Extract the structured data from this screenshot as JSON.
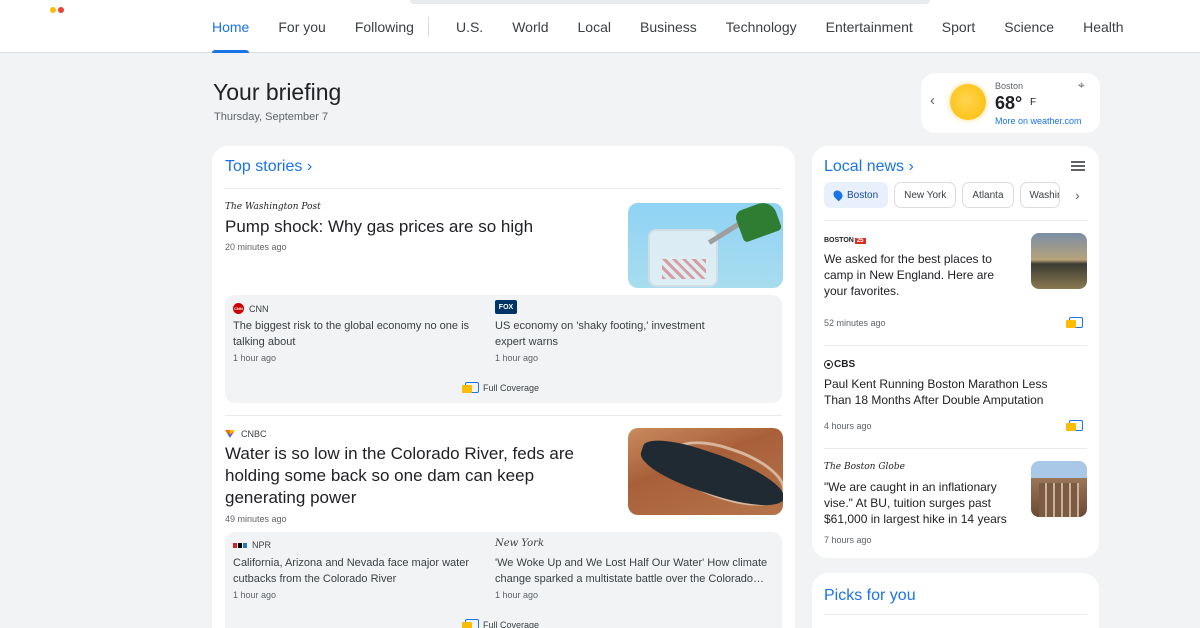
{
  "nav": {
    "items": [
      "Home",
      "For you",
      "Following",
      "U.S.",
      "World",
      "Local",
      "Business",
      "Technology",
      "Entertainment",
      "Sport",
      "Science",
      "Health"
    ],
    "active": "Home"
  },
  "briefing": {
    "title": "Your briefing",
    "date": "Thursday, September 7"
  },
  "weather": {
    "city": "Boston",
    "temp": "68°",
    "unit": "F",
    "more": "More on weather.com",
    "icon": "sun-icon"
  },
  "top_stories": {
    "heading": "Top stories",
    "stories": [
      {
        "source": "The Washington Post",
        "headline": "Pump shock: Why gas prices are so high",
        "time": "20 minutes ago",
        "related": [
          {
            "source": "CNN",
            "text": "The biggest risk to the global economy no one is talking about",
            "time": "1 hour ago"
          },
          {
            "source": "FOX",
            "text": "US economy on 'shaky footing,' investment expert warns",
            "time": "1 hour ago"
          }
        ],
        "full_coverage": "Full Coverage"
      },
      {
        "source": "CNBC",
        "headline": "Water is so low in the Colorado River, feds are holding some back so one dam can keep generating power",
        "time": "49 minutes ago",
        "related": [
          {
            "source": "NPR",
            "text": "California, Arizona and Nevada face major water cutbacks from the Colorado River",
            "time": "1 hour ago"
          },
          {
            "source": "New York",
            "text": "'We Woke Up and We Lost Half Our Water' How climate change sparked a multistate battle over the Colorado…",
            "time": "1 hour ago"
          }
        ],
        "full_coverage": "Full Coverage"
      }
    ]
  },
  "local_news": {
    "heading": "Local news",
    "chips": [
      "Boston",
      "New York",
      "Atlanta",
      "Washington"
    ],
    "active_chip": "Boston",
    "stories": [
      {
        "source": "BOSTON",
        "source_badge": "25",
        "headline": "We asked for the best places to camp in New England. Here are your favorites.",
        "time": "52 minutes ago"
      },
      {
        "source": "CBS",
        "headline": "Paul Kent Running Boston Marathon Less Than 18 Months After Double Amputation",
        "time": "4 hours ago"
      },
      {
        "source": "The Boston Globe",
        "headline": "\"We are caught in an inflationary vise.\" At BU, tuition surges past $61,000 in largest hike in 14 years",
        "time": "7 hours ago"
      }
    ]
  },
  "picks": {
    "heading": "Picks for you"
  },
  "colors": {
    "accent": "#1a73e8",
    "background": "#f1f3f4",
    "card": "#ffffff"
  }
}
